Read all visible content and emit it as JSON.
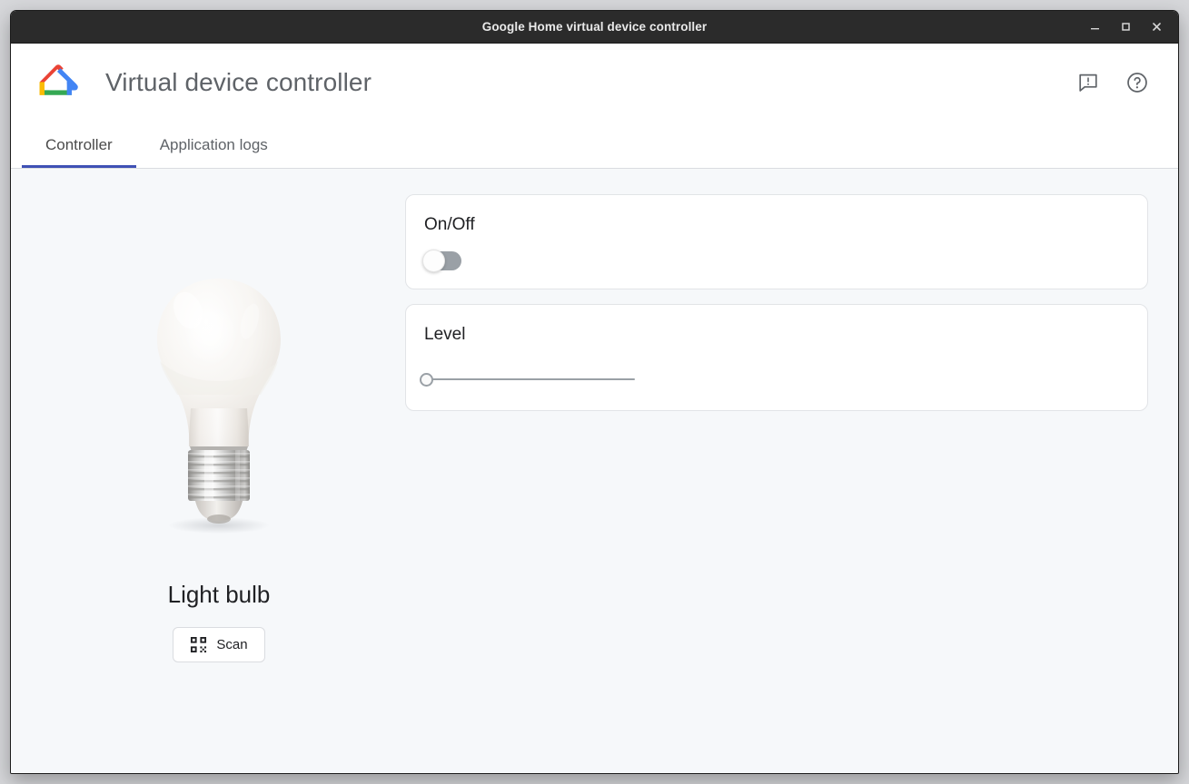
{
  "window": {
    "title": "Google Home virtual device controller",
    "controls": {
      "minimize": "minimize-button",
      "maximize": "maximize-button",
      "close": "close-button"
    }
  },
  "header": {
    "logo": "google-home-logo",
    "title": "Virtual device controller",
    "actions": [
      {
        "name": "feedback-icon",
        "label": "Send feedback"
      },
      {
        "name": "help-icon",
        "label": "Help"
      }
    ]
  },
  "tabs": [
    {
      "label": "Controller",
      "active": true
    },
    {
      "label": "Application logs",
      "active": false
    }
  ],
  "device": {
    "image": "light-bulb-image",
    "name": "Light bulb",
    "scan_button": {
      "label": "Scan",
      "icon": "qr-code-icon"
    }
  },
  "traits": [
    {
      "title": "On/Off",
      "control": "toggle",
      "value": "off"
    },
    {
      "title": "Level",
      "control": "slider",
      "value": "0",
      "min": "0",
      "max": "100"
    }
  ],
  "colors": {
    "accent": "#3f51b5",
    "titlebar": "#2b2b2b",
    "background": "#f6f8fa",
    "card": "#ffffff",
    "logo_red": "#ea4335",
    "logo_blue": "#4285f4",
    "logo_yellow": "#fbbc05",
    "logo_green": "#34a853"
  }
}
